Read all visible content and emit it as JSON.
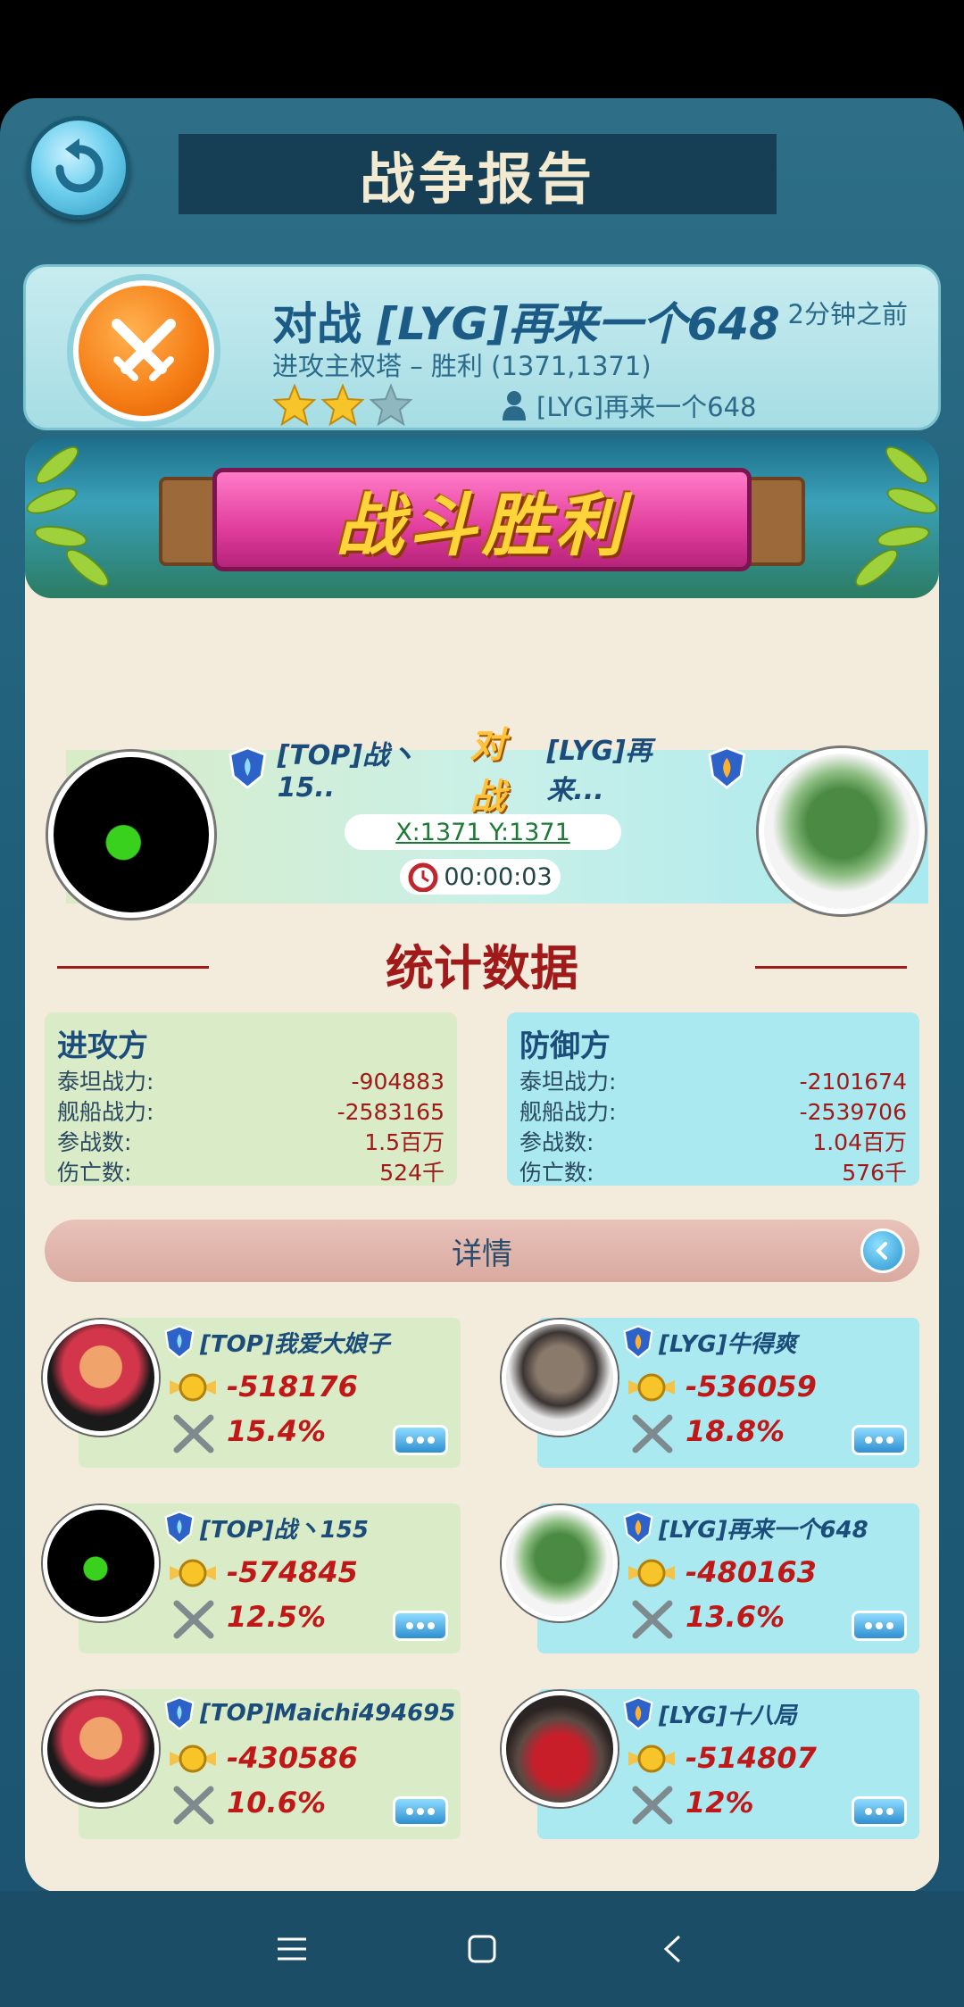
{
  "header": {
    "title": "战争报告"
  },
  "summary": {
    "title_prefix": "对战 ",
    "title_name": "[LYG]再来一个648",
    "time": "2分钟之前",
    "subtitle": "进攻主权塔 – 胜利 (1371,1371)",
    "stars_filled": 2,
    "stars_total": 3,
    "player": "[LYG]再来一个648"
  },
  "banner": {
    "text": "战斗胜利"
  },
  "versus": {
    "attacker": "[TOP]战丶15..",
    "vs": "对战",
    "defender": "[LYG]再来...",
    "coords": "X:1371 Y:1371",
    "timer": "00:00:03"
  },
  "stats": {
    "title": "统计数据",
    "attacker": {
      "head": "进攻方",
      "rows": [
        {
          "k": "泰坦战力:",
          "v": "-904883"
        },
        {
          "k": "舰船战力:",
          "v": "-2583165"
        },
        {
          "k": "参战数:",
          "v": "1.5百万"
        },
        {
          "k": "伤亡数:",
          "v": "524千"
        }
      ]
    },
    "defender": {
      "head": "防御方",
      "rows": [
        {
          "k": "泰坦战力:",
          "v": "-2101674"
        },
        {
          "k": "舰船战力:",
          "v": "-2539706"
        },
        {
          "k": "参战数:",
          "v": "1.04百万"
        },
        {
          "k": "伤亡数:",
          "v": "576千"
        }
      ]
    }
  },
  "details": {
    "label": "详情"
  },
  "attackers": [
    {
      "name": "[TOP]我爱大娘子",
      "power": "-518176",
      "percent": "15.4%"
    },
    {
      "name": "[TOP]战丶155",
      "power": "-574845",
      "percent": "12.5%"
    },
    {
      "name": "[TOP]Maichi494695",
      "power": "-430586",
      "percent": "10.6%"
    }
  ],
  "defenders": [
    {
      "name": "[LYG]牛得爽",
      "power": "-536059",
      "percent": "18.8%"
    },
    {
      "name": "[LYG]再来一个648",
      "power": "-480163",
      "percent": "13.6%"
    },
    {
      "name": "[LYG]十八局",
      "power": "-514807",
      "percent": "12%"
    }
  ]
}
